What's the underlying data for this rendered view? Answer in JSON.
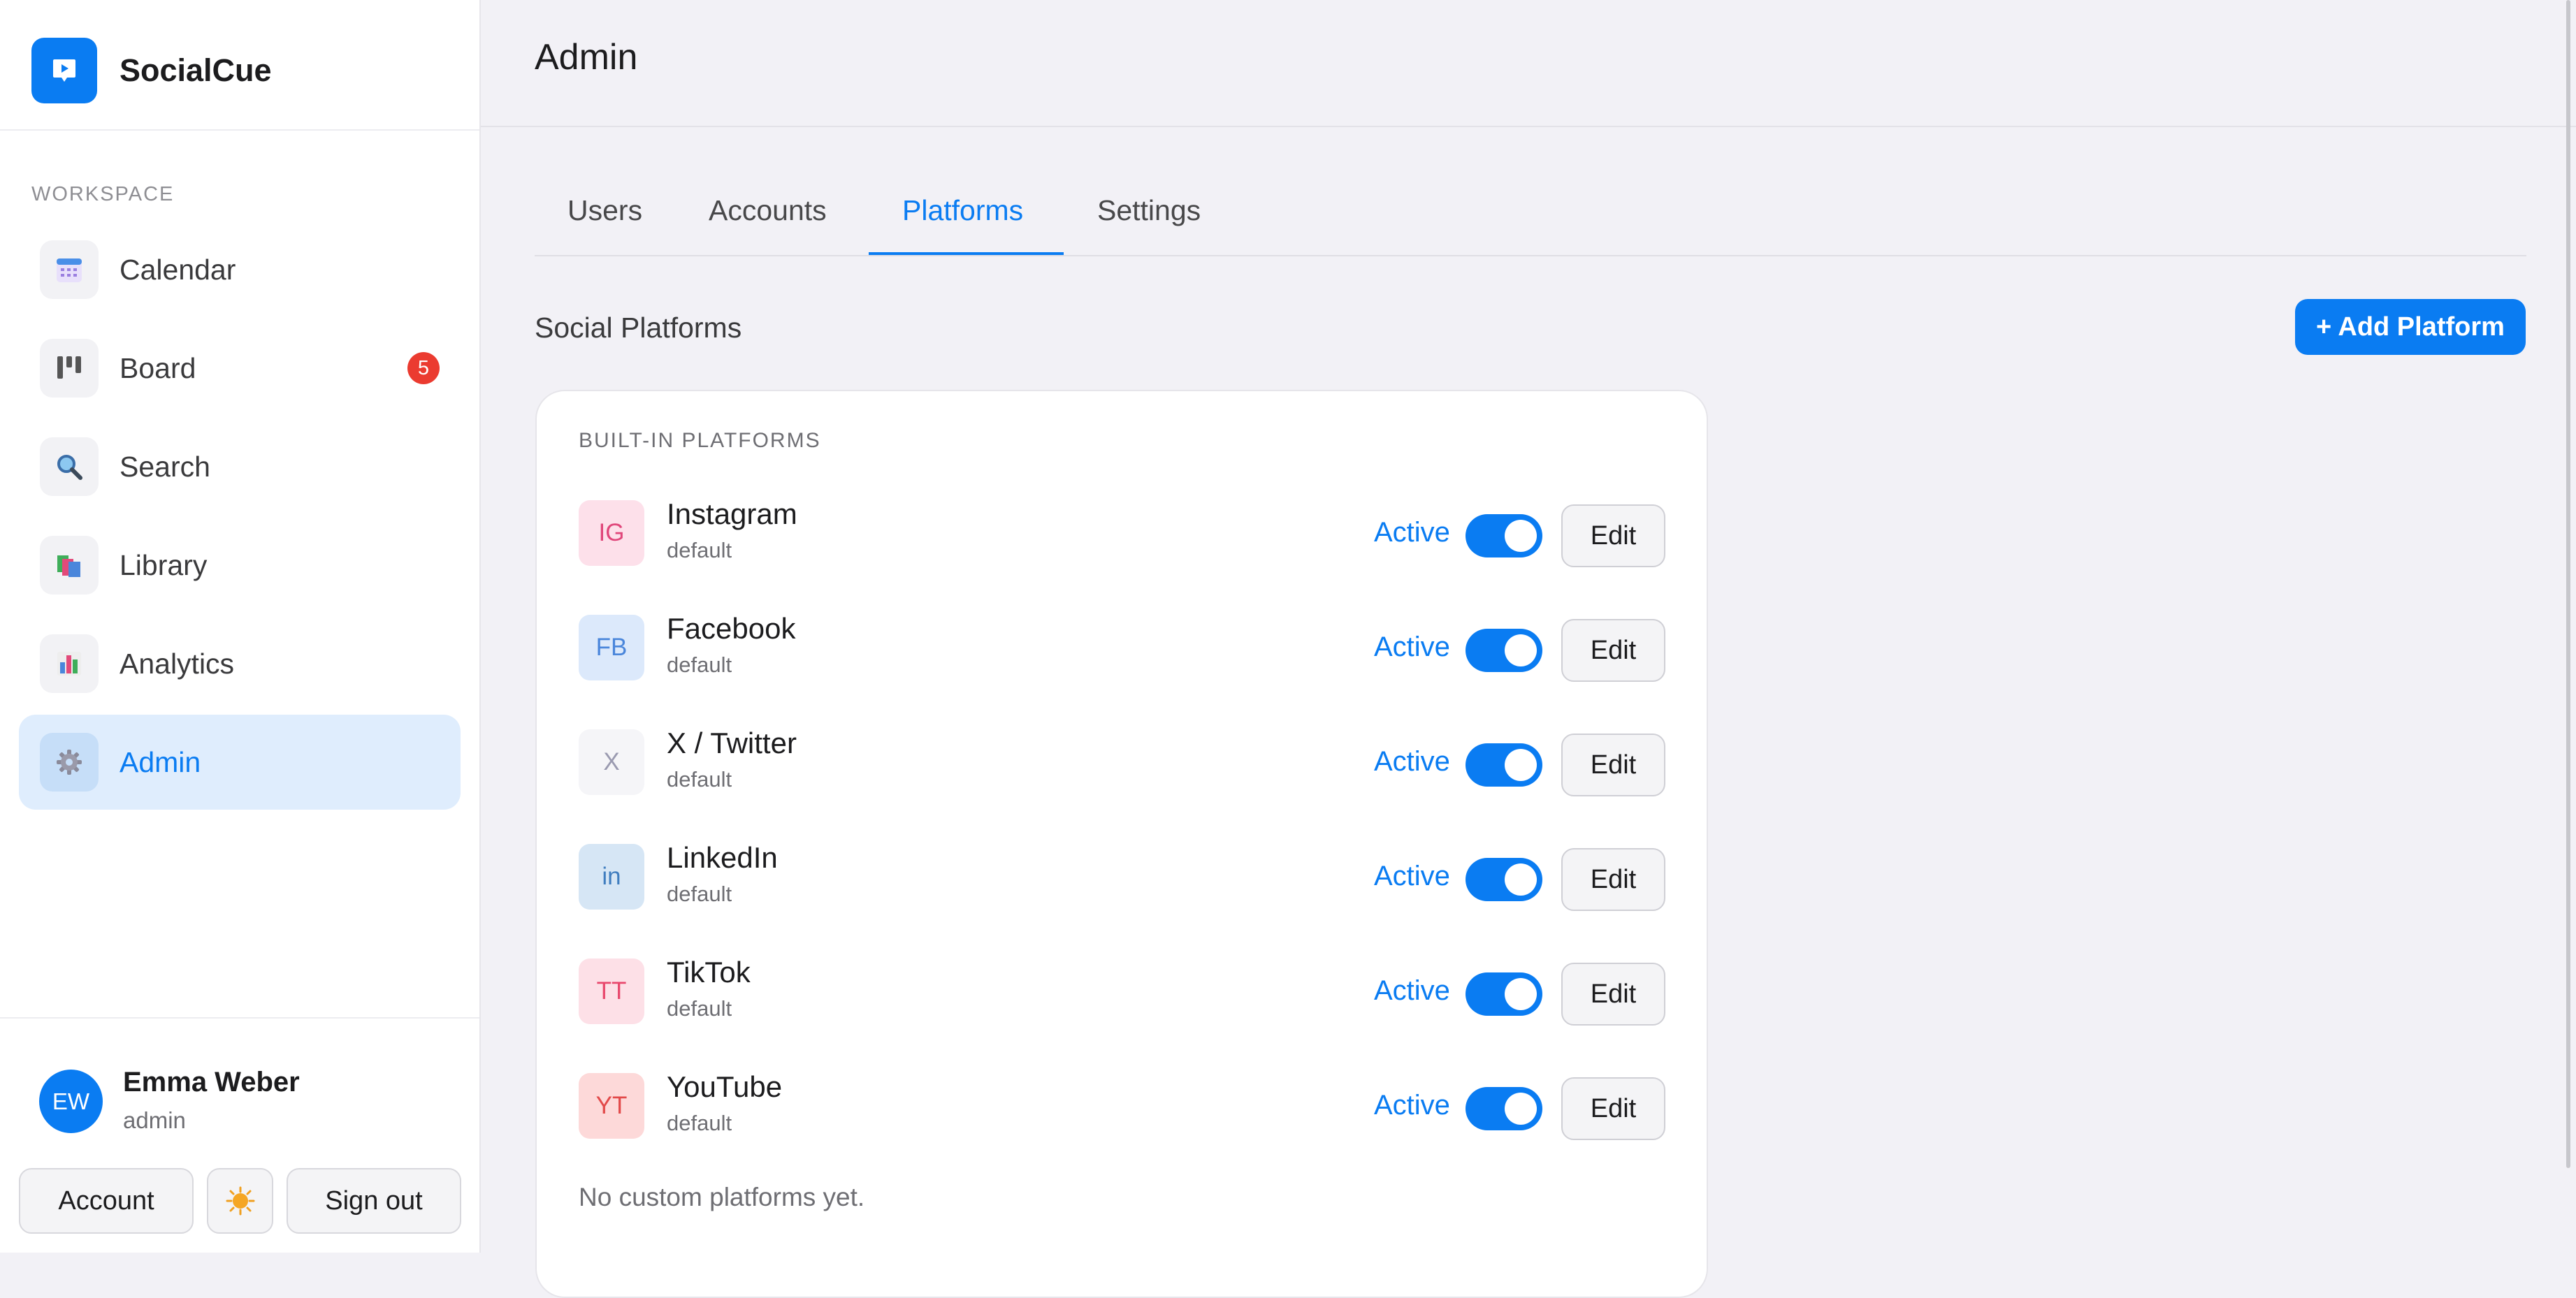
{
  "app": {
    "name": "SocialCue",
    "accent": "#0a7cf2"
  },
  "sidebar": {
    "section_label": "WORKSPACE",
    "items": [
      {
        "label": "Calendar",
        "icon": "calendar-icon"
      },
      {
        "label": "Board",
        "icon": "kanban-board-icon",
        "badge": "5"
      },
      {
        "label": "Search",
        "icon": "magnifier-icon"
      },
      {
        "label": "Library",
        "icon": "books-icon"
      },
      {
        "label": "Analytics",
        "icon": "bar-chart-icon"
      },
      {
        "label": "Admin",
        "icon": "gear-icon",
        "active": true
      }
    ],
    "user": {
      "initials": "EW",
      "name": "Emma Weber",
      "role": "admin"
    },
    "account_label": "Account",
    "theme_icon": "sun-icon",
    "signout_label": "Sign out"
  },
  "header": {
    "title": "Admin"
  },
  "tabs": [
    {
      "label": "Users"
    },
    {
      "label": "Accounts"
    },
    {
      "label": "Platforms",
      "active": true
    },
    {
      "label": "Settings"
    }
  ],
  "main": {
    "section_title": "Social Platforms",
    "add_button": "+ Add Platform",
    "card_label": "BUILT-IN PLATFORMS",
    "platforms": [
      {
        "abbr": "IG",
        "name": "Instagram",
        "sub": "default",
        "status": "Active",
        "enabled": true,
        "edit": "Edit",
        "bg": "#fde0ea",
        "fg": "#e0467a"
      },
      {
        "abbr": "FB",
        "name": "Facebook",
        "sub": "default",
        "status": "Active",
        "enabled": true,
        "edit": "Edit",
        "bg": "#dce9fb",
        "fg": "#4a86db"
      },
      {
        "abbr": "X",
        "name": "X / Twitter",
        "sub": "default",
        "status": "Active",
        "enabled": true,
        "edit": "Edit",
        "bg": "#f5f5f8",
        "fg": "#9a9ab0"
      },
      {
        "abbr": "in",
        "name": "LinkedIn",
        "sub": "default",
        "status": "Active",
        "enabled": true,
        "edit": "Edit",
        "bg": "#d6e6f5",
        "fg": "#3f7dbf"
      },
      {
        "abbr": "TT",
        "name": "TikTok",
        "sub": "default",
        "status": "Active",
        "enabled": true,
        "edit": "Edit",
        "bg": "#fde0e7",
        "fg": "#e8476c"
      },
      {
        "abbr": "YT",
        "name": "YouTube",
        "sub": "default",
        "status": "Active",
        "enabled": true,
        "edit": "Edit",
        "bg": "#fdd9d9",
        "fg": "#e24a4a"
      }
    ],
    "empty_note": "No custom platforms yet."
  }
}
